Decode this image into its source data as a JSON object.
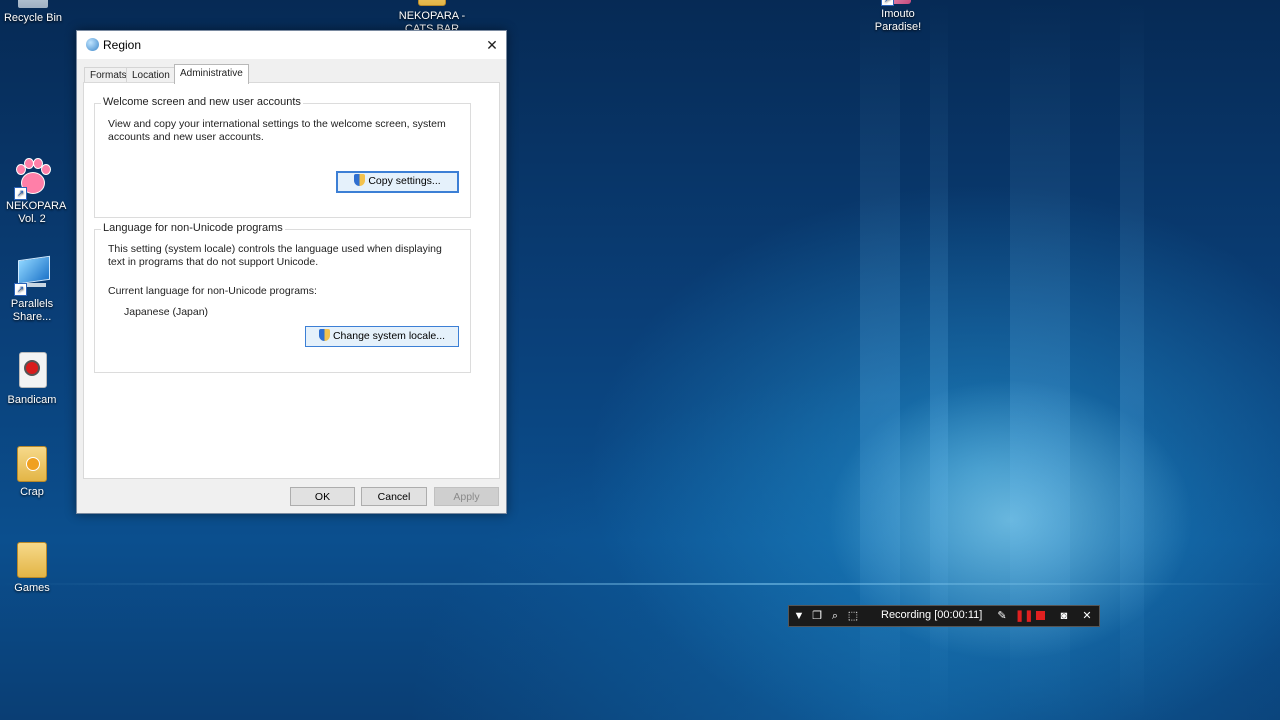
{
  "desktop": {
    "icons": [
      {
        "label": "Recycle Bin"
      },
      {
        "label": "NEKOPARA - CATS BAR"
      },
      {
        "label": "Imouto Paradise!"
      },
      {
        "label": "NEKOPARA Vol. 2"
      },
      {
        "label": "Parallels Share..."
      },
      {
        "label": "Bandicam"
      },
      {
        "label": "Crap"
      },
      {
        "label": "Games"
      }
    ]
  },
  "dialog": {
    "title": "Region",
    "close_glyph": "✕",
    "tabs": [
      {
        "label": "Formats"
      },
      {
        "label": "Location"
      },
      {
        "label": "Administrative"
      }
    ],
    "welcome_group": {
      "title": "Welcome screen and new user accounts",
      "description": "View and copy your international settings to the welcome screen, system accounts and new user accounts.",
      "button": "Copy settings..."
    },
    "locale_group": {
      "title": "Language for non-Unicode programs",
      "description": "This setting (system locale) controls the language used when displaying text in programs that do not support Unicode.",
      "current_label": "Current language for non-Unicode programs:",
      "current_value": "Japanese (Japan)",
      "button": "Change system locale..."
    },
    "footer": {
      "ok": "OK",
      "cancel": "Cancel",
      "apply": "Apply"
    }
  },
  "recording_bar": {
    "status": "Recording [00:00:11]",
    "icons": [
      "dropdown-icon",
      "window-icon",
      "zoom-icon",
      "region-icon",
      "pencil-icon",
      "pause-icon",
      "stop-icon",
      "camera-icon",
      "close-icon"
    ]
  }
}
